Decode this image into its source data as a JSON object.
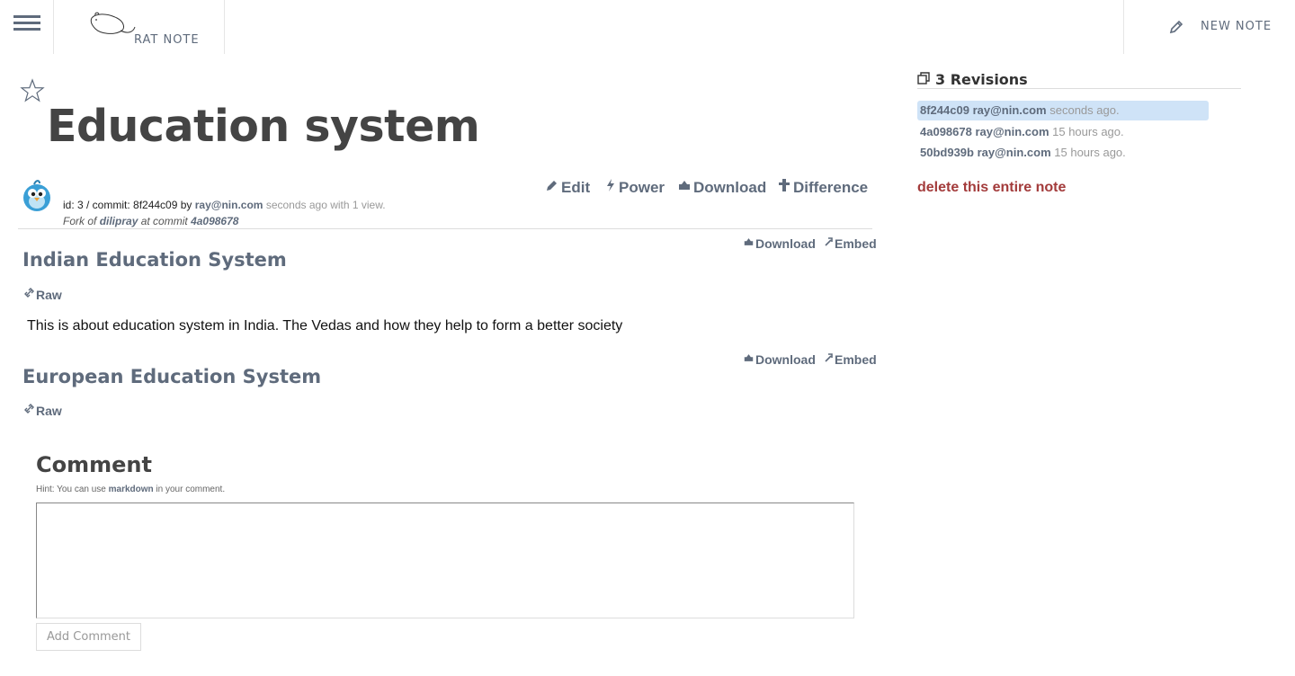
{
  "header": {
    "logo_text": "RAT NOTE",
    "new_note_label": "NEW NOTE",
    "accent_color": "#5f6b7c"
  },
  "note": {
    "title": "Education system",
    "meta": {
      "id_prefix": "id: 3 / commit: 8f244c09 by ",
      "author": "ray@nin.com",
      "time": " seconds ago with 1 view.",
      "fork_prefix": "Fork of ",
      "fork_user": "dilipray",
      "fork_mid": " at commit ",
      "fork_commit": "4a098678"
    },
    "actions": {
      "edit": "Edit",
      "power": "Power",
      "download": "Download",
      "difference": "Difference"
    }
  },
  "files": [
    {
      "title": "Indian Education System",
      "raw_label": "Raw",
      "download_label": "Download",
      "embed_label": "Embed",
      "body": "This is about education system in India. The Vedas and how they help to form a better society"
    },
    {
      "title": "European Education System",
      "raw_label": "Raw",
      "download_label": "Download",
      "embed_label": "Embed",
      "body": ""
    }
  ],
  "comment": {
    "heading": "Comment",
    "hint_prefix": "Hint: You can use ",
    "hint_link": "markdown",
    "hint_suffix": " in your comment.",
    "textarea_value": "",
    "button_label": "Add Comment"
  },
  "sidebar": {
    "revisions_title": "3 Revisions",
    "revisions": [
      {
        "hash": "8f244c09",
        "user": "ray@nin.com",
        "time": "seconds ago.",
        "active": true
      },
      {
        "hash": "4a098678",
        "user": "ray@nin.com",
        "time": "15 hours ago.",
        "active": false
      },
      {
        "hash": "50bd939b",
        "user": "ray@nin.com",
        "time": "15 hours ago.",
        "active": false
      }
    ],
    "delete_label": "delete this entire note",
    "delete_color": "#a33b3b"
  }
}
